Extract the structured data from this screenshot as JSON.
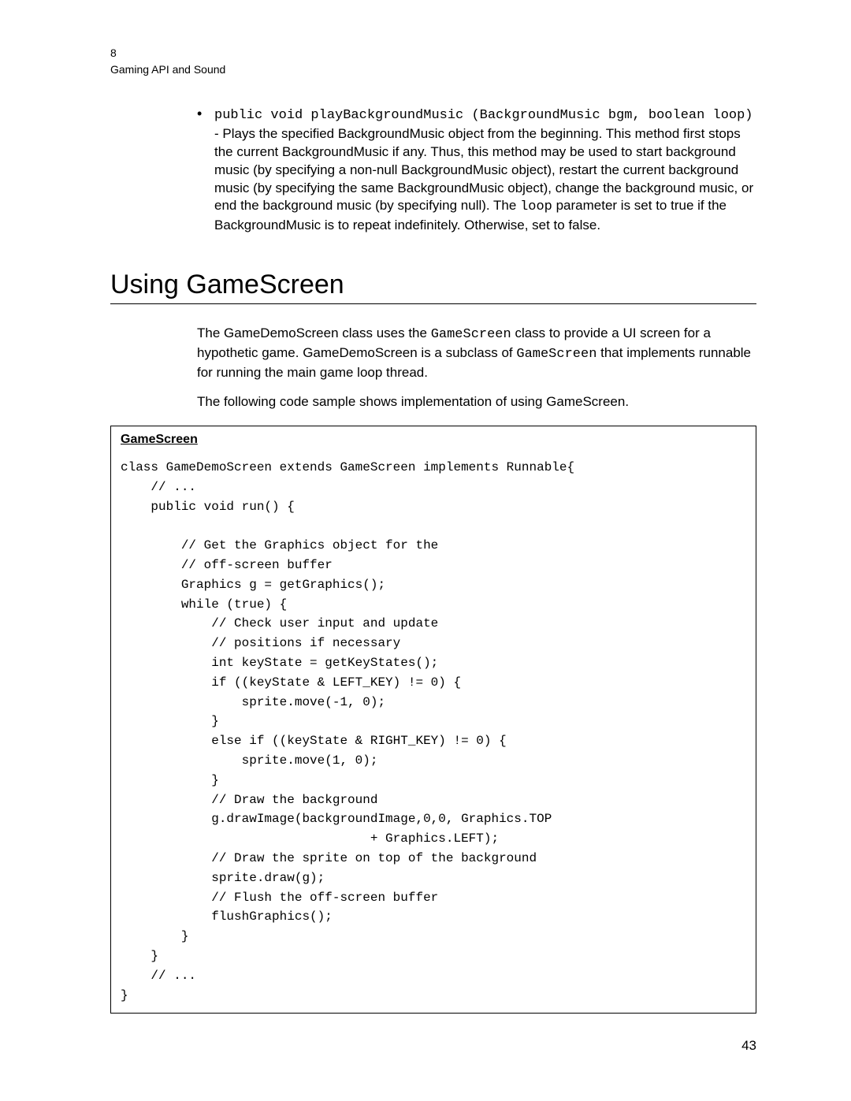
{
  "header": {
    "chapter_number": "8",
    "chapter_title": "Gaming API and Sound"
  },
  "bullet": {
    "code_sig": "public void playBackgroundMusic (BackgroundMusic bgm, boolean loop)",
    "desc_part1": " - Plays the specified BackgroundMusic object from the beginning. This method first stops the current BackgroundMusic if any. Thus, this method may be used to start background music (by specifying a non-null BackgroundMusic object), restart the current background music (by specifying the same BackgroundMusic object), change the background music, or end the background music (by specifying null). The ",
    "code_inline": "loop",
    "desc_part2": " parameter is set to true if the BackgroundMusic is to repeat indefinitely. Otherwise, set to false."
  },
  "section_title": "Using GameScreen",
  "para1": {
    "t1": "The GameDemoScreen class uses the ",
    "c1": "GameScreen",
    "t2": " class to provide a UI screen for a hypothetic game.  GameDemoScreen is a subclass of ",
    "c2": "GameScreen",
    "t3": " that implements runnable for running the main game loop thread."
  },
  "para2": "The following code sample shows implementation of using GameScreen.",
  "code_title": "GameScreen",
  "code_body": "class GameDemoScreen extends GameScreen implements Runnable{\n    // ...\n    public void run() {\n\n        // Get the Graphics object for the\n        // off-screen buffer\n        Graphics g = getGraphics();\n        while (true) {\n            // Check user input and update\n            // positions if necessary\n            int keyState = getKeyStates();\n            if ((keyState & LEFT_KEY) != 0) {\n                sprite.move(-1, 0);\n            }\n            else if ((keyState & RIGHT_KEY) != 0) {\n                sprite.move(1, 0);\n            }\n            // Draw the background\n            g.drawImage(backgroundImage,0,0, Graphics.TOP\n                                 + Graphics.LEFT);\n            // Draw the sprite on top of the background\n            sprite.draw(g);\n            // Flush the off-screen buffer\n            flushGraphics();\n        }\n    }\n    // ...\n}",
  "page_number": "43"
}
